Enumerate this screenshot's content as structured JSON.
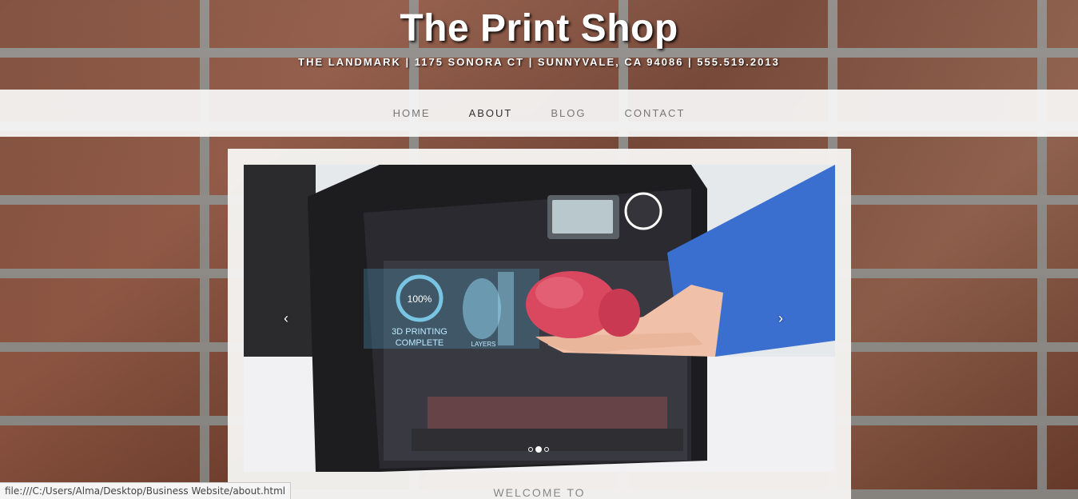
{
  "header": {
    "title": "The Print Shop",
    "address": "THE LANDMARK | 1175 SONORA CT | SUNNYVALE, CA 94086 | 555.519.2013"
  },
  "nav": {
    "items": [
      {
        "label": "HOME"
      },
      {
        "label": "ABOUT"
      },
      {
        "label": "BLOG"
      },
      {
        "label": "CONTACT"
      }
    ],
    "active": "ABOUT"
  },
  "carousel": {
    "slide_overlay": {
      "percent": "100%",
      "caption_line1": "3D PRINTING",
      "caption_line2": "COMPLETE",
      "layers_label": "LAYERS"
    },
    "prev_icon": "chevron-left-icon",
    "next_icon": "chevron-right-icon",
    "prev_glyph": "‹",
    "next_glyph": "›",
    "slide_count": 3,
    "active_index": 1
  },
  "main": {
    "welcome": "WELCOME TO"
  },
  "status_bar": {
    "url": "file:///C:/Users/Alma/Desktop/Business Website/about.html"
  },
  "colors": {
    "accent_blue": "#3a6fd0",
    "overlay_cyan": "#5fc4e8",
    "heart_pink": "#d9485f"
  }
}
